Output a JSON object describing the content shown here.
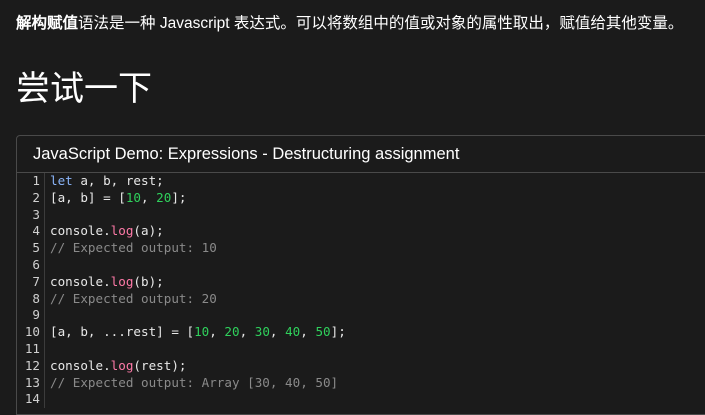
{
  "intro": {
    "bold": "解构赋值",
    "text": "语法是一种 Javascript 表达式。可以将数组中的值或对象的属性取出，赋值给其他变量。"
  },
  "heading": "尝试一下",
  "demo": {
    "title": "JavaScript Demo: Expressions - Destructuring assignment",
    "lines": [
      {
        "num": "1",
        "parts": [
          {
            "t": "kw",
            "v": "let"
          },
          {
            "t": "p",
            "v": " a, b, rest;"
          }
        ]
      },
      {
        "num": "2",
        "parts": [
          {
            "t": "p",
            "v": "[a, b] = ["
          },
          {
            "t": "num",
            "v": "10"
          },
          {
            "t": "p",
            "v": ", "
          },
          {
            "t": "num",
            "v": "20"
          },
          {
            "t": "p",
            "v": "];"
          }
        ]
      },
      {
        "num": "3",
        "parts": []
      },
      {
        "num": "4",
        "parts": [
          {
            "t": "p",
            "v": "console."
          },
          {
            "t": "fn",
            "v": "log"
          },
          {
            "t": "p",
            "v": "(a);"
          }
        ]
      },
      {
        "num": "5",
        "parts": [
          {
            "t": "cm",
            "v": "// Expected output: 10"
          }
        ]
      },
      {
        "num": "6",
        "parts": []
      },
      {
        "num": "7",
        "parts": [
          {
            "t": "p",
            "v": "console."
          },
          {
            "t": "fn",
            "v": "log"
          },
          {
            "t": "p",
            "v": "(b);"
          }
        ]
      },
      {
        "num": "8",
        "parts": [
          {
            "t": "cm",
            "v": "// Expected output: 20"
          }
        ]
      },
      {
        "num": "9",
        "parts": []
      },
      {
        "num": "10",
        "parts": [
          {
            "t": "p",
            "v": "[a, b, ...rest] = ["
          },
          {
            "t": "num",
            "v": "10"
          },
          {
            "t": "p",
            "v": ", "
          },
          {
            "t": "num",
            "v": "20"
          },
          {
            "t": "p",
            "v": ", "
          },
          {
            "t": "num",
            "v": "30"
          },
          {
            "t": "p",
            "v": ", "
          },
          {
            "t": "num",
            "v": "40"
          },
          {
            "t": "p",
            "v": ", "
          },
          {
            "t": "num",
            "v": "50"
          },
          {
            "t": "p",
            "v": "];"
          }
        ]
      },
      {
        "num": "11",
        "parts": []
      },
      {
        "num": "12",
        "parts": [
          {
            "t": "p",
            "v": "console."
          },
          {
            "t": "fn",
            "v": "log"
          },
          {
            "t": "p",
            "v": "(rest);"
          }
        ]
      },
      {
        "num": "13",
        "parts": [
          {
            "t": "cm",
            "v": "// Expected output: Array [30, 40, 50]"
          }
        ]
      },
      {
        "num": "14",
        "parts": []
      }
    ]
  },
  "colors": {
    "background": "#1b1b1b",
    "keyword": "#8ab4f8",
    "function": "#ff7aa8",
    "number": "#2fd15c",
    "comment": "#8a8a8a"
  }
}
